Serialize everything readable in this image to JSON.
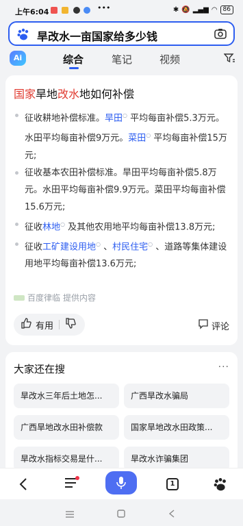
{
  "status_bar": {
    "time": "上午6:04",
    "battery": "86"
  },
  "search": {
    "query": "旱改水一亩国家给多少钱"
  },
  "tabs": {
    "ai_label": "Ai",
    "items": [
      "综合",
      "笔记",
      "视频"
    ]
  },
  "answer": {
    "title_parts": [
      "国家",
      "旱地",
      "改水",
      "地如何补偿"
    ],
    "bullets": [
      {
        "segments": [
          {
            "text": "征收耕地补偿标准。",
            "link": false
          },
          {
            "text": "旱田",
            "link": true
          },
          {
            "text": " 平均每亩补偿5.3万元。水田平均每亩补偿9万元。",
            "link": false
          },
          {
            "text": "菜田",
            "link": true
          },
          {
            "text": " 平均每亩补偿15万元;",
            "link": false
          }
        ]
      },
      {
        "segments": [
          {
            "text": "征收基本农田补偿标准。旱田平均每亩补偿5.8万元。水田平均每亩补偿9.9万元。菜田平均每亩补偿15.6万元;",
            "link": false
          }
        ]
      },
      {
        "segments": [
          {
            "text": "征收",
            "link": false
          },
          {
            "text": "林地",
            "link": true
          },
          {
            "text": " 及其他农用地平均每亩补偿13.8万元;",
            "link": false
          }
        ]
      },
      {
        "segments": [
          {
            "text": "征收",
            "link": false
          },
          {
            "text": "工矿建设用地",
            "link": true
          },
          {
            "text": " 、",
            "link": false
          },
          {
            "text": "村民住宅",
            "link": true
          },
          {
            "text": " 、道路等集体建设用地平均每亩补偿13.6万元;",
            "link": false
          }
        ]
      }
    ],
    "source_name": "百度律临",
    "source_suffix": "提供内容",
    "useful_label": "有用",
    "comment_label": "评论"
  },
  "related": {
    "title": "大家还在搜",
    "more": "···",
    "chips": [
      "旱改水三年后土地怎...",
      "广西旱改水骗局",
      "广西旱地改水田补偿款",
      "国家旱地改水田政策...",
      "旱改水指标交易是什...",
      "旱改水诈骗集团"
    ]
  },
  "toolbar": {
    "tab_count": "1"
  },
  "colors": {
    "accent": "#2c5df0",
    "highlight": "#e03a2f",
    "mic": "#4e6ef2"
  }
}
